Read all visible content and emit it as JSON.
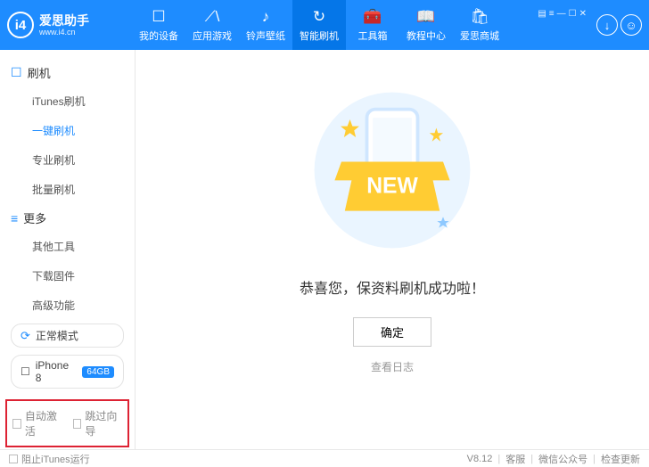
{
  "header": {
    "logo_char": "i4",
    "app_name": "爱思助手",
    "site": "www.i4.cn",
    "nav": [
      {
        "icon": "☐",
        "label": "我的设备"
      },
      {
        "icon": "⟋\\",
        "label": "应用游戏"
      },
      {
        "icon": "♪",
        "label": "铃声壁纸"
      },
      {
        "icon": "↻",
        "label": "智能刷机"
      },
      {
        "icon": "🧰",
        "label": "工具箱"
      },
      {
        "icon": "📖",
        "label": "教程中心"
      },
      {
        "icon": "🛍",
        "label": "爱思商城"
      }
    ],
    "win": [
      "▤",
      "≡",
      "—",
      "☐",
      "✕"
    ]
  },
  "sidebar": {
    "group1": {
      "title": "刷机",
      "items": [
        "iTunes刷机",
        "一键刷机",
        "专业刷机",
        "批量刷机"
      ]
    },
    "group2": {
      "title": "更多",
      "items": [
        "其他工具",
        "下载固件",
        "高级功能"
      ]
    },
    "mode": "正常模式",
    "device": {
      "name": "iPhone 8",
      "storage": "64GB"
    },
    "checks": {
      "auto_activate": "自动激活",
      "skip_guide": "跳过向导"
    }
  },
  "main": {
    "success": "恭喜您，保资料刷机成功啦！",
    "ok": "确定",
    "log": "查看日志",
    "ribbon": "NEW"
  },
  "footer": {
    "block_itunes": "阻止iTunes运行",
    "version": "V8.12",
    "support": "客服",
    "wechat": "微信公众号",
    "update": "检查更新"
  }
}
